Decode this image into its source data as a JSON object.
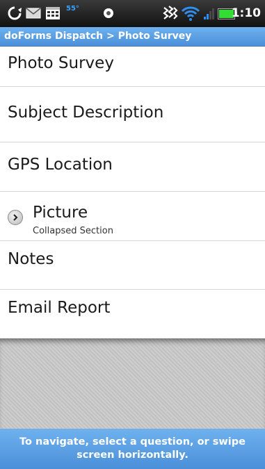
{
  "status_bar": {
    "time": "1:10",
    "temperature": "55°",
    "icons": [
      "sync-icon",
      "mail-icon",
      "calendar-icon",
      "weather-icon",
      "vibrate-icon",
      "wifi-icon",
      "signal-icon",
      "battery-icon"
    ]
  },
  "title_bar": {
    "breadcrumb": "doForms Dispatch > Photo Survey"
  },
  "list": {
    "items": [
      {
        "label": "Photo Survey"
      },
      {
        "label": "Subject Description"
      },
      {
        "label": "GPS Location"
      },
      {
        "label": "Picture",
        "sublabel": "Collapsed Section",
        "icon": "chevron-right-icon"
      },
      {
        "label": "Notes"
      },
      {
        "label": "Email Report"
      }
    ]
  },
  "footer": {
    "hint": "To navigate, select a question, or swipe screen horizontally."
  },
  "colors": {
    "accent_blue": "#5a9fe3",
    "status_bar": "#1e1e1e",
    "battery_green": "#33dd33",
    "wifi_blue": "#2f8ff0"
  }
}
